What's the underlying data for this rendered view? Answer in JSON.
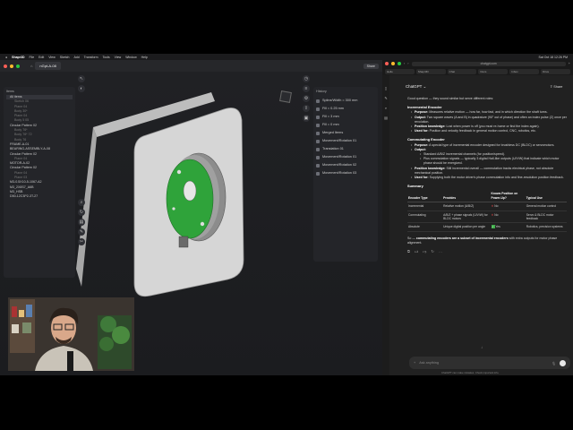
{
  "menubar": {
    "app": "Shapr3D",
    "items": [
      "File",
      "Edit",
      "View",
      "Sketch",
      "Add",
      "Transform",
      "Tools",
      "View",
      "Window",
      "Help"
    ],
    "clock": "Sat Oct 18 12:26 PM"
  },
  "shapr": {
    "tab_title": "nGpt-A-08",
    "share_label": "Share",
    "viewport_hint": "Perspective view",
    "items_panel": {
      "header": "Items",
      "all_items": "All items",
      "rows": [
        {
          "label": "Sketch 06",
          "style": "dim"
        },
        {
          "label": "Plane 04",
          "style": "dim"
        },
        {
          "label": "Body 30*",
          "style": "dim"
        },
        {
          "label": "Plane 04",
          "style": "dim"
        },
        {
          "label": "Body 5 05",
          "style": "dim"
        },
        {
          "label": "Circular Pattern 02",
          "style": "normal"
        },
        {
          "label": "Body 76*",
          "style": "dim"
        },
        {
          "label": "Body 76* 72",
          "style": "dim"
        },
        {
          "label": "Body 76",
          "style": "dim"
        },
        {
          "label": "FRAME-A-01",
          "style": "normal"
        },
        {
          "label": "BEARING-ASSEMBLY-A-08",
          "style": "normal"
        },
        {
          "label": "Circular Pattern 02",
          "style": "normal"
        },
        {
          "label": "Plane 04",
          "style": "dim"
        },
        {
          "label": "MOTOR-A-02",
          "style": "normal"
        },
        {
          "label": "Circular Pattern 02",
          "style": "normal"
        },
        {
          "label": "Plane 04",
          "style": "dim"
        },
        {
          "label": "Plane 03",
          "style": "dim"
        },
        {
          "label": "M3-0.5X10-5-1067-A2",
          "style": "normal"
        },
        {
          "label": "M3_2X8S7_A6B",
          "style": "normal"
        },
        {
          "label": "M3_HSB",
          "style": "normal"
        },
        {
          "label": "D50-12C3P2-3T-27",
          "style": "normal"
        }
      ]
    },
    "history": {
      "header": "History",
      "rows": [
        "Spline/Width = 300 mm",
        "Fill = 0.25 mm",
        "Fill = 3 mm",
        "Fill = 0 mm",
        "Merged Items",
        "Movement/Rotation 01",
        "Translation 01",
        "Movement/Rotation 01",
        "Movement/Rotation 02",
        "Movement/Rotation 03"
      ]
    }
  },
  "browser": {
    "url": "chatgpt.com",
    "tabs": [
      "Hello",
      "Shapr3D",
      "Chat",
      "Docs",
      "Inbox",
      "Drive"
    ],
    "header": "ChatGPT",
    "share": "Share",
    "intro": "Good question — they sound similar but serve different roles:",
    "incremental": {
      "title": "Incremental Encoder",
      "bullets": [
        {
          "k": "Purpose:",
          "v": "Measures relative motion — how far, how fast, and in which direction the shaft turns."
        },
        {
          "k": "Output:",
          "v": "Two square waves (A and B) in quadrature (90° out of phase) and often an index pulse (Z) once per revolution."
        },
        {
          "k": "Position knowledge:",
          "v": "Lost when power is off (you must re-home or find the index again)."
        },
        {
          "k": "Used for:",
          "v": "Position and velocity feedback in general motion control, CNC, robotics, etc."
        }
      ]
    },
    "commutating": {
      "title": "Commutating Encoder",
      "purpose_k": "Purpose:",
      "purpose_v": "A special type of incremental encoder designed for brushless DC (BLDC) or servomotors.",
      "output_k": "Output:",
      "output_sub": [
        "Standard A/B/Z incremental channels (for position/speed).",
        "Plus commutation signals — typically 3 digital Hall-like outputs (U/V/W) that indicate which motor phase should be energized."
      ],
      "position_k": "Position knowledge:",
      "position_v": "Still incremental overall — commutation tracks electrical phase, not absolute mechanical position.",
      "used_k": "Used for:",
      "used_v": "Supplying both the motor driver's phase commutation info and fine-resolution position feedback."
    },
    "summary": {
      "title": "Summary",
      "headers": [
        "Encoder Type",
        "Provides",
        "Knows Position on Power-Up?",
        "Typical Use"
      ],
      "rows": [
        {
          "type": "Incremental",
          "provides": "Relative motion (A/B/Z)",
          "mark": "cross",
          "knows": "No",
          "use": "General motion control"
        },
        {
          "type": "Commutating",
          "provides": "A/B/Z + phase signals (U/V/W) for BLDC motors",
          "mark": "cross",
          "knows": "No",
          "use": "Servo & BLDC motor feedback"
        },
        {
          "type": "Absolute",
          "provides": "Unique digital position per angle",
          "mark": "check",
          "knows": "Yes",
          "use": "Robotics, precision systems"
        }
      ]
    },
    "conclusion_prefix": "So — ",
    "conclusion_bold": "commutating encoders are a subset of incremental encoders",
    "conclusion_rest": " with extra outputs for motor phase alignment.",
    "input_placeholder": "Ask anything",
    "footer": "ChatGPT can make mistakes. Check important info."
  },
  "colors": {
    "encoder_green": "#2fa33a",
    "part_gray": "#d4d4d4",
    "accent_red": "#e04545"
  }
}
